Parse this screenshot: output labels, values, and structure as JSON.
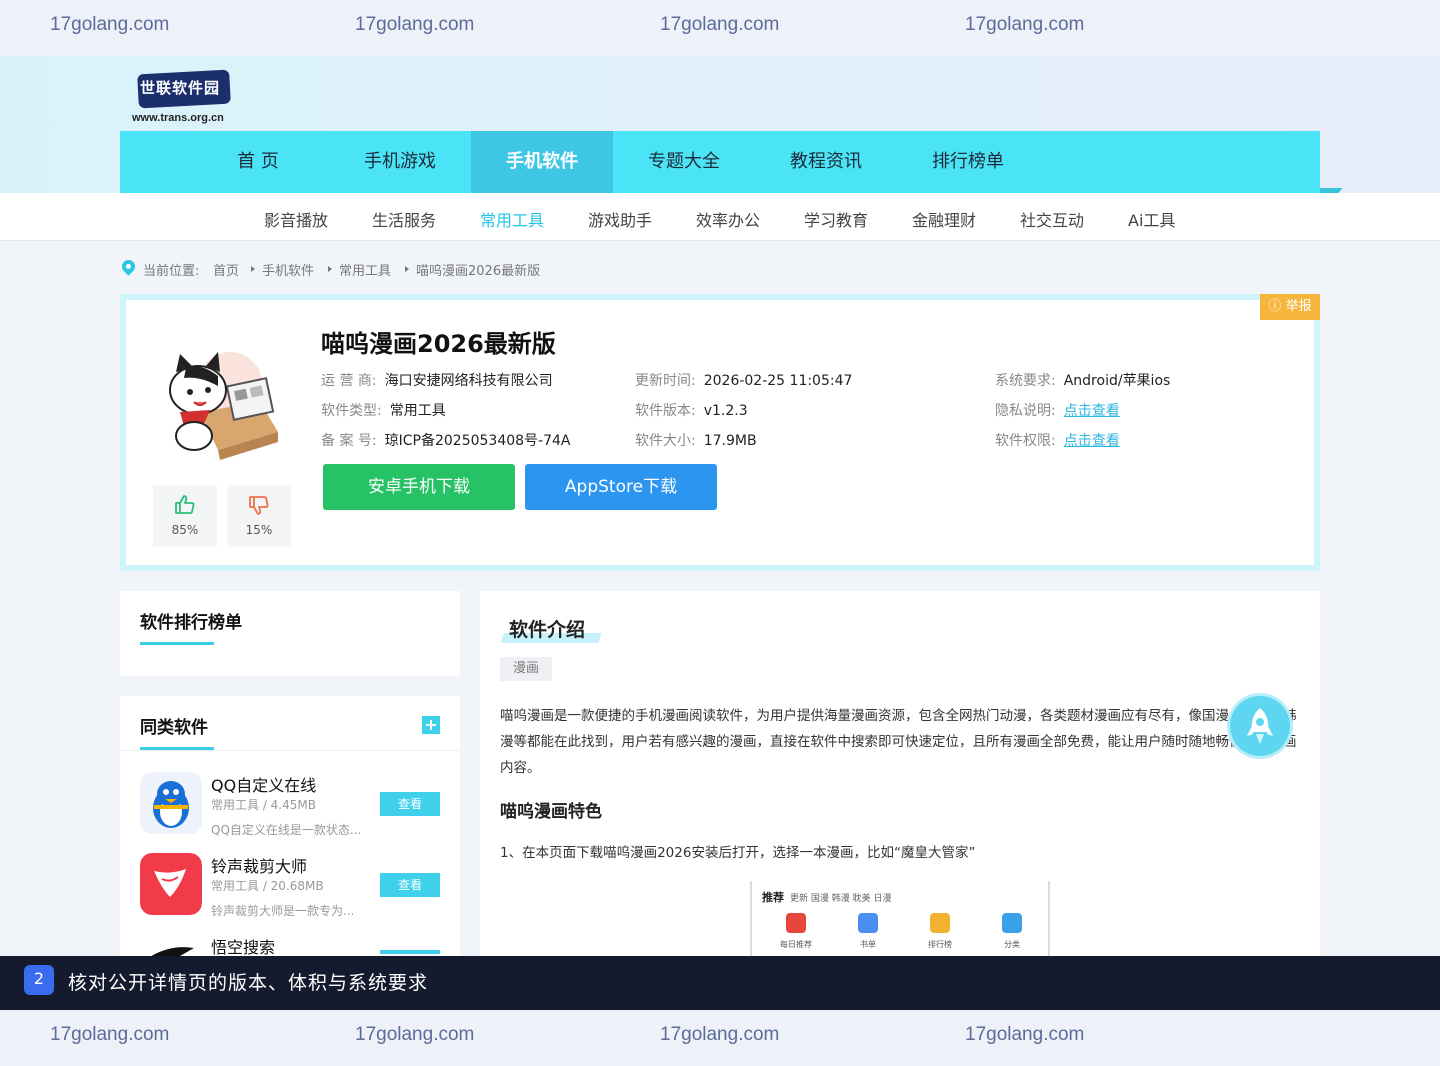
{
  "watermark": "17golang.com",
  "logo": {
    "name": "世联软件园",
    "url": "www.trans.org.cn"
  },
  "main_nav": [
    "首 页",
    "手机游戏",
    "手机软件",
    "专题大全",
    "教程资讯",
    "排行榜单"
  ],
  "main_nav_active": "手机软件",
  "sub_nav": [
    "影音播放",
    "生活服务",
    "常用工具",
    "游戏助手",
    "效率办公",
    "学习教育",
    "金融理财",
    "社交互动",
    "Ai工具"
  ],
  "sub_nav_active": "常用工具",
  "breadcrumb": {
    "prefix": "当前位置:",
    "items": [
      "首页",
      "手机软件",
      "常用工具",
      "喵呜漫画2026最新版"
    ]
  },
  "app": {
    "title": "喵呜漫画2026最新版",
    "report_label": "举报",
    "meta": {
      "operator": {
        "k": "运 营 商:",
        "v": "海口安捷网络科技有限公司"
      },
      "type": {
        "k": "软件类型:",
        "v": "常用工具"
      },
      "icp": {
        "k": "备 案 号:",
        "v": "琼ICP备2025053408号-74A"
      },
      "updated": {
        "k": "更新时间:",
        "v": "2026-02-25 11:05:47"
      },
      "version": {
        "k": "软件版本:",
        "v": "v1.2.3"
      },
      "size": {
        "k": "软件大小:",
        "v": "17.9MB"
      },
      "system": {
        "k": "系统要求:",
        "v": "Android/苹果ios"
      },
      "privacy": {
        "k": "隐私说明:",
        "v": "点击查看"
      },
      "permission": {
        "k": "软件权限:",
        "v": "点击查看"
      }
    },
    "vote_up": "85%",
    "vote_down": "15%",
    "btn_android": "安卓手机下载",
    "btn_ios": "AppStore下载"
  },
  "ranking": {
    "title": "软件排行榜单"
  },
  "similar": {
    "title": "同类软件",
    "items": [
      {
        "name": "QQ自定义在线",
        "info": "常用工具 / 4.45MB",
        "desc": "QQ自定义在线是一款状态...",
        "view": "查看"
      },
      {
        "name": "铃声裁剪大师",
        "info": "常用工具 / 20.68MB",
        "desc": "铃声裁剪大师是一款专为...",
        "view": "查看"
      },
      {
        "name": "悟空搜索",
        "info": "",
        "desc": "",
        "view": ""
      }
    ]
  },
  "intro": {
    "title": "软件介绍",
    "tag": "漫画",
    "paragraph": "喵呜漫画是一款便捷的手机漫画阅读软件，为用户提供海量漫画资源，包含全网热门动漫，各类题材漫画应有尽有，像国漫、日漫、韩漫等都能在此找到，用户若有感兴趣的漫画，直接在软件中搜索即可快速定位，且所有漫画全部免费，能让用户随时随地畅快阅读漫画内容。",
    "features_title": "喵呜漫画特色",
    "step1": "1、在本页面下载喵呜漫画2026安装后打开，选择一本漫画，比如“魔皇大管家”",
    "screenshot": {
      "tabs_active": "推荐",
      "tabs": "更新  国漫  韩漫  耽美  日漫",
      "items": [
        "每日推荐",
        "书单",
        "排行榜",
        "分类"
      ]
    }
  },
  "banner": {
    "step": "2",
    "text": "核对公开详情页的版本、体积与系统要求"
  },
  "colors": {
    "accent": "#4be3f6",
    "android": "#27c266",
    "ios": "#2b95ef",
    "report": "#f6b63d"
  }
}
